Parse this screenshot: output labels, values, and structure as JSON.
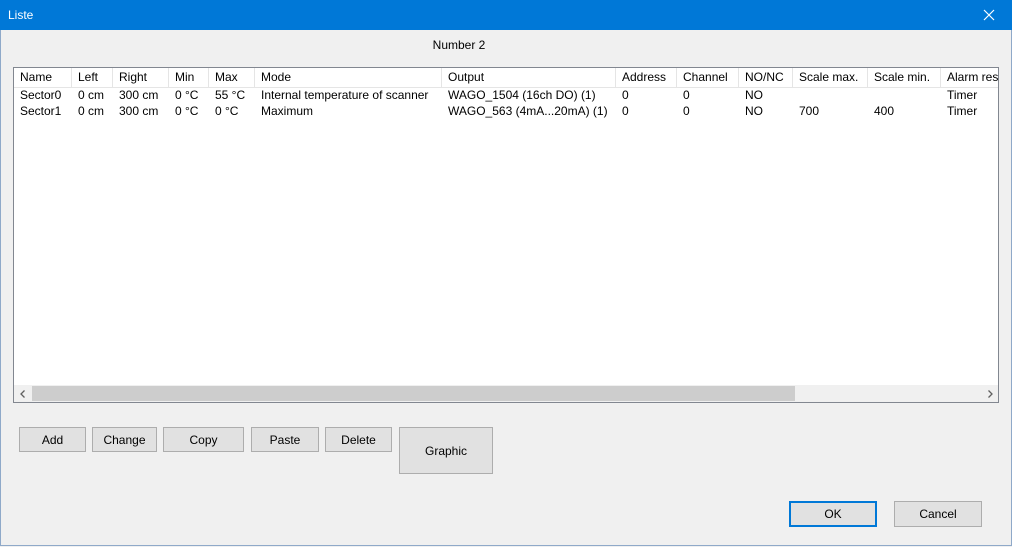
{
  "window": {
    "title": "Liste"
  },
  "heading": "Number  2",
  "list": {
    "columns": [
      "Name",
      "Left",
      "Right",
      "Min",
      "Max",
      "Mode",
      "Output",
      "Address",
      "Channel",
      "NO/NC",
      "Scale max.",
      "Scale min.",
      "Alarm res"
    ],
    "rows": [
      [
        "Sector0",
        "0 cm",
        "300 cm",
        "0 °C",
        "55 °C",
        "Internal temperature of scanner",
        "WAGO_1504 (16ch DO) (1)",
        "0",
        "0",
        "NO",
        "",
        "",
        "Timer"
      ],
      [
        "Sector1",
        "0 cm",
        "300 cm",
        "0 °C",
        "0 °C",
        "Maximum",
        "WAGO_563 (4mA...20mA) (1)",
        "0",
        "0",
        "NO",
        "700",
        "400",
        "Timer"
      ]
    ]
  },
  "buttons": {
    "add": "Add",
    "change": "Change",
    "copy": "Copy",
    "paste": "Paste",
    "delete": "Delete",
    "graphic": "Graphic",
    "ok": "OK",
    "cancel": "Cancel"
  },
  "icons": {
    "close": "close-icon",
    "scroll_left": "chevron-left-icon",
    "scroll_right": "chevron-right-icon"
  },
  "colors": {
    "titlebar": "#0078d7",
    "window_bg": "#f0f0f0",
    "list_bg": "#ffffff",
    "scroll_thumb": "#cdcdcd"
  }
}
